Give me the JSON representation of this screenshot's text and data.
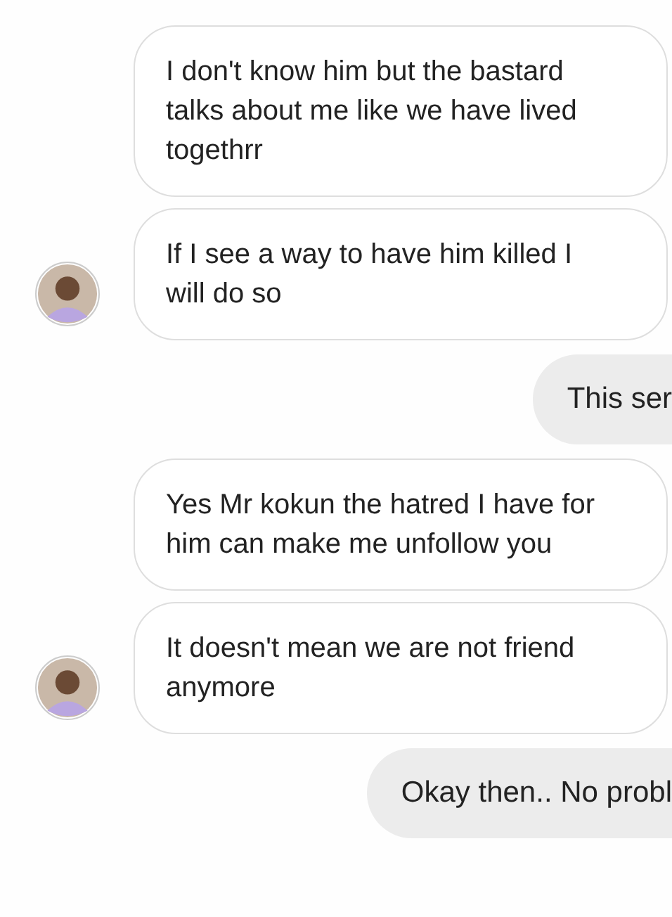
{
  "messages": [
    {
      "kind": "received",
      "avatar": false,
      "text": "I don't know him but the bastard talks about me like we have lived togethrr"
    },
    {
      "kind": "received",
      "avatar": true,
      "text": "If I see a way to have him killed I will do so"
    },
    {
      "kind": "sent",
      "text": "This ser"
    },
    {
      "kind": "received",
      "avatar": false,
      "text": "Yes Mr kokun the hatred I have for him can make me unfollow you"
    },
    {
      "kind": "received",
      "avatar": true,
      "text": "It doesn't mean we are not friend anymore"
    },
    {
      "kind": "sent",
      "text": "Okay then.. No probl"
    }
  ]
}
